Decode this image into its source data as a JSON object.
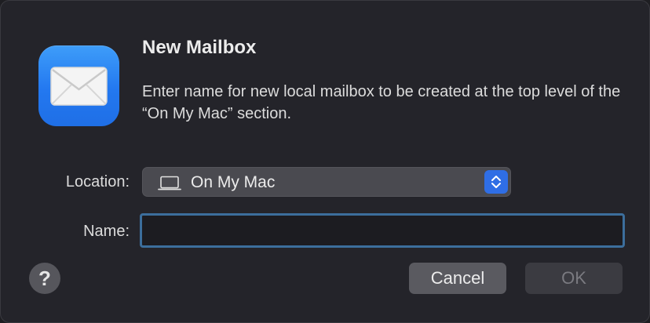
{
  "dialog": {
    "title": "New Mailbox",
    "message": "Enter name for new local mailbox to be created at the top level of the “On My Mac” section.",
    "app_icon": "mail-envelope-icon"
  },
  "form": {
    "location_label": "Location:",
    "location_value": "On My Mac",
    "location_icon": "laptop-icon",
    "name_label": "Name:",
    "name_value": "",
    "name_placeholder": ""
  },
  "buttons": {
    "help_label": "?",
    "cancel_label": "Cancel",
    "ok_label": "OK"
  },
  "colors": {
    "accent": "#2f6ee5",
    "focus_ring": "#3c6e9c",
    "app_icon_top": "#3e9df9",
    "app_icon_bottom": "#1f6fe6"
  }
}
